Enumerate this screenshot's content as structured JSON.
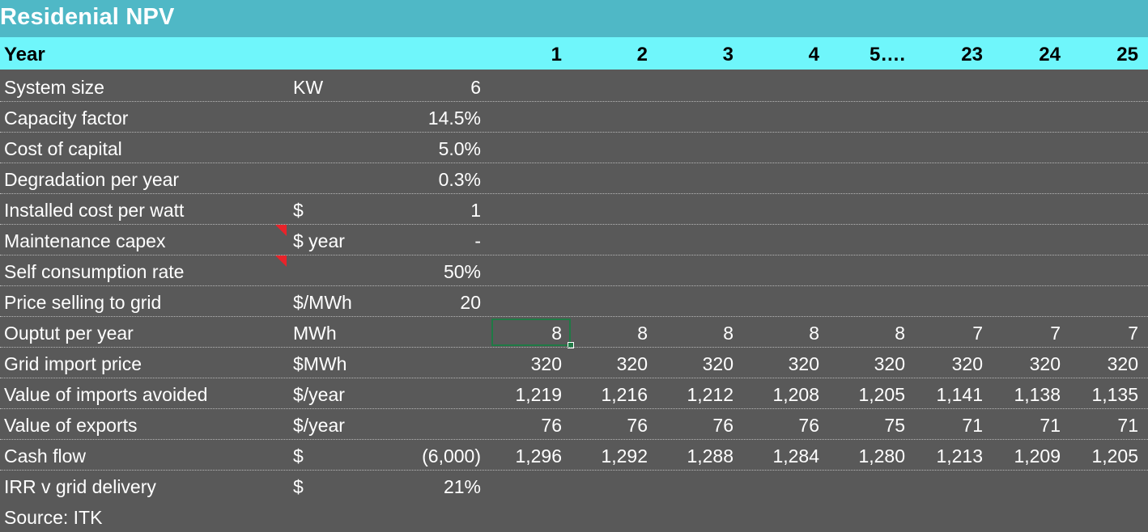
{
  "title": "Residenial NPV",
  "header": {
    "label": "Year",
    "years": [
      "1",
      "2",
      "3",
      "4",
      "5….",
      "23",
      "24",
      "25"
    ]
  },
  "rows": [
    {
      "label": "System size",
      "unit": "KW",
      "value": "6",
      "years": []
    },
    {
      "label": "Capacity factor",
      "unit": "",
      "value": "14.5%",
      "years": []
    },
    {
      "label": "Cost of capital",
      "unit": "",
      "value": "5.0%",
      "years": []
    },
    {
      "label": "Degradation per year",
      "unit": "",
      "value": "0.3%",
      "years": []
    },
    {
      "label": "Installed cost per watt",
      "unit": "$",
      "value": "1",
      "years": []
    },
    {
      "label": "Maintenance capex",
      "unit": "$ year",
      "value": "-",
      "years": [],
      "comment": true
    },
    {
      "label": "Self consumption rate",
      "unit": "",
      "value": "50%",
      "years": [],
      "comment": true
    },
    {
      "label": "Price selling to grid",
      "unit": "$/MWh",
      "value": "20",
      "years": []
    },
    {
      "label": "Ouptut per year",
      "unit": "MWh",
      "value": "",
      "years": [
        "8",
        "8",
        "8",
        "8",
        "8",
        "7",
        "7",
        "7"
      ]
    },
    {
      "label": "Grid import price",
      "unit": "$MWh",
      "value": "",
      "years": [
        "320",
        "320",
        "320",
        "320",
        "320",
        "320",
        "320",
        "320"
      ]
    },
    {
      "label": "Value of imports avoided",
      "unit": "$/year",
      "value": "",
      "years": [
        "1,219",
        "1,216",
        "1,212",
        "1,208",
        "1,205",
        "1,141",
        "1,138",
        "1,135"
      ]
    },
    {
      "label": "Value of exports",
      "unit": "$/year",
      "value": "",
      "years": [
        "76",
        "76",
        "76",
        "76",
        "75",
        "71",
        "71",
        "71"
      ]
    },
    {
      "label": "Cash flow",
      "unit": "$",
      "value": "(6,000)",
      "years": [
        "1,296",
        "1,292",
        "1,288",
        "1,284",
        "1,280",
        "1,213",
        "1,209",
        "1,205"
      ]
    },
    {
      "label": "IRR v grid delivery",
      "unit": "$",
      "value": "21%",
      "years": []
    }
  ],
  "source": "Source: ITK",
  "colors": {
    "title_bg": "#4fb8c6",
    "header_bg": "#6ff6fb",
    "body_bg": "#595959",
    "comment_marker": "#e8232a",
    "selection_border": "#1f7a45"
  }
}
